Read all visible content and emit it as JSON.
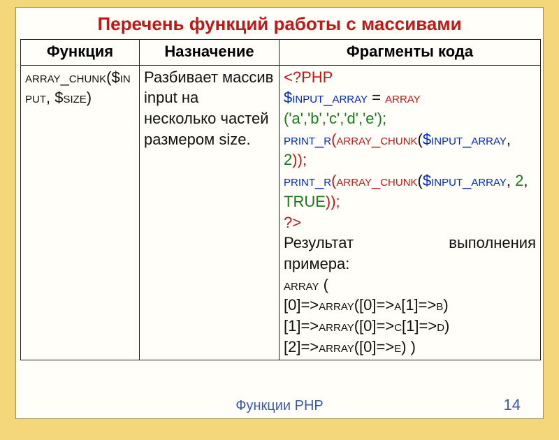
{
  "title": "Перечень функций работы с массивами",
  "headers": {
    "c1": "Функция",
    "c2": "Назначение",
    "c3": "Фрагменты кода"
  },
  "row": {
    "func": "array_chunk($input, $size)",
    "desc": "Разбивает массив input на несколько частей размером size."
  },
  "code": {
    "l1": "<?PHP",
    "l2a": "$INPUT_ARRAY",
    "l2b": " = ",
    "l2c": "ARRAY",
    "l3": "('a','b','c','d','e');",
    "l4a": "PRINT_R",
    "l4b": "(",
    "l4c": "ARRAY_CHUNK",
    "l4d": "(",
    "l4e": "$INPUT_ARRAY",
    "l4f": ", ",
    "l4g": "2",
    "l4h": "));",
    "l5a": "PRINT_R",
    "l5b": "(",
    "l5c": "ARRAY_CHUNK",
    "l5d": "(",
    "l5e": "$INPUT_ARRAY",
    "l5f": ", ",
    "l5g": "2",
    "l5h": ", ",
    "l5i": "TRUE",
    "l5j": "));",
    "l6": "?>"
  },
  "result": {
    "label_l": "Результат",
    "label_r": "выполнения",
    "label2": "примера:",
    "arr_open": "Array (",
    "o1": "[0]=>Array([0]=>a[1]=>b)",
    "o2": "[1]=>Array([0]=>c[1]=>d)",
    "o3": "[2]=>Array([0]=>e) )"
  },
  "footer": "Функции PHP",
  "page": "14"
}
